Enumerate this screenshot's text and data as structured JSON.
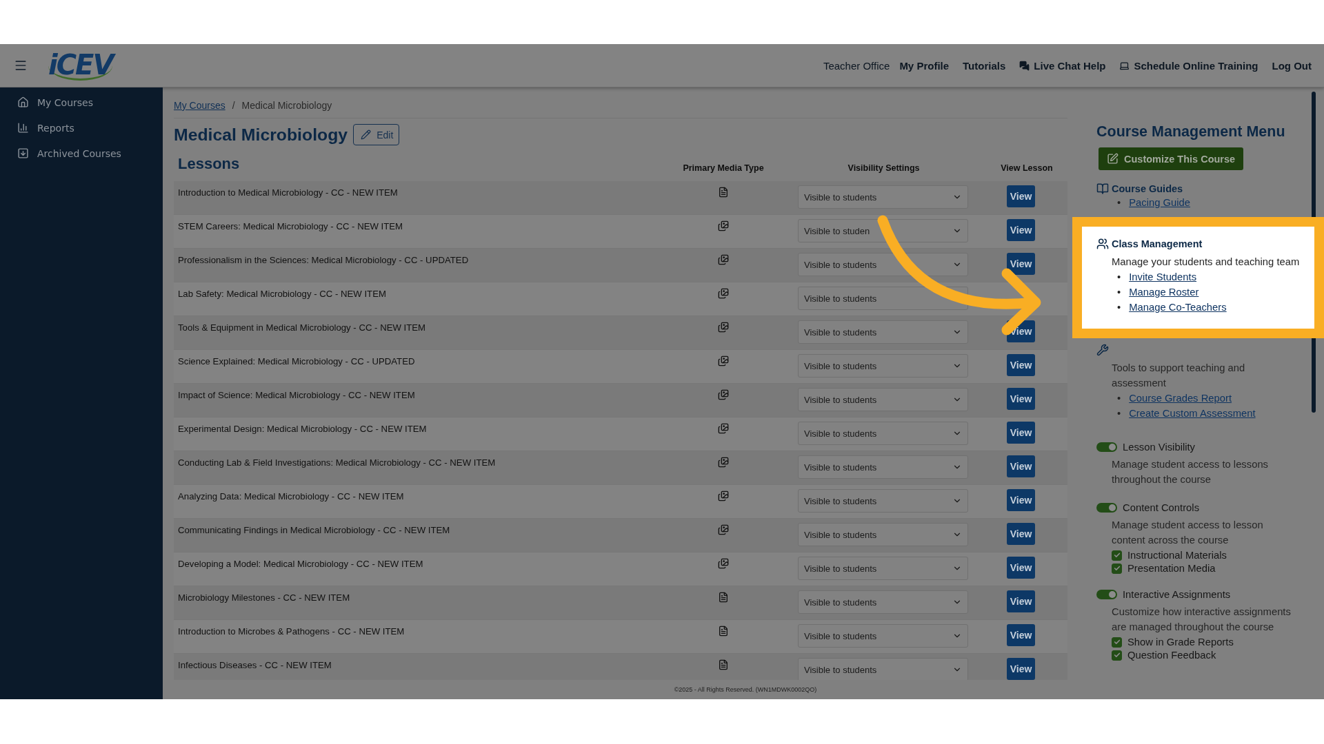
{
  "header": {
    "logo": "iCEV",
    "nav": [
      {
        "label": "Teacher Office",
        "selected": true
      },
      {
        "label": "My Profile",
        "selected": false
      },
      {
        "label": "Tutorials",
        "selected": false
      },
      {
        "label": "Live Chat Help",
        "selected": false
      },
      {
        "label": "Schedule Online Training",
        "selected": false
      },
      {
        "label": "Log Out",
        "selected": false
      }
    ]
  },
  "sidebar": {
    "items": [
      {
        "label": "My Courses"
      },
      {
        "label": "Reports"
      },
      {
        "label": "Archived Courses"
      }
    ]
  },
  "breadcrumb": {
    "link": "My Courses",
    "separator": "/",
    "current": "Medical Microbiology"
  },
  "course": {
    "title": "Medical Microbiology",
    "edit_button": "Edit"
  },
  "lessons": {
    "heading": "Lessons",
    "columns": [
      "Primary Media Type",
      "Visibility Settings",
      "View Lesson"
    ],
    "rows": [
      {
        "title": "Introduction to Medical Microbiology - CC - NEW ITEM",
        "kind": "document",
        "visibility": "Visible to students",
        "action": "View"
      },
      {
        "title": "STEM Careers: Medical Microbiology - CC - NEW ITEM",
        "kind": "slides",
        "visibility": "Visible to studen",
        "action": "View"
      },
      {
        "title": "Professionalism in the Sciences: Medical Microbiology - CC - UPDATED",
        "kind": "slides",
        "visibility": "Visible to students",
        "action": "View"
      },
      {
        "title": "Lab Safety: Medical Microbiology - CC - NEW ITEM",
        "kind": "slides",
        "visibility": "Visible to students"
      },
      {
        "title": "Tools & Equipment in Medical Microbiology - CC - NEW ITEM",
        "kind": "slides",
        "visibility": "Visible to students",
        "action": "View"
      },
      {
        "title": "Science Explained: Medical Microbiology - CC - UPDATED",
        "kind": "slides",
        "visibility": "Visible to students",
        "action": "View"
      },
      {
        "title": "Impact of Science: Medical Microbiology - CC - NEW ITEM",
        "kind": "slides",
        "visibility": "Visible to students",
        "action": "View"
      },
      {
        "title": "Experimental Design: Medical Microbiology - CC - NEW ITEM",
        "kind": "slides",
        "visibility": "Visible to students",
        "action": "View"
      },
      {
        "title": "Conducting Lab & Field Investigations: Medical Microbiology - CC - NEW ITEM",
        "kind": "slides",
        "visibility": "Visible to students",
        "action": "View"
      },
      {
        "title": "Analyzing Data: Medical Microbiology - CC - NEW ITEM",
        "kind": "slides",
        "visibility": "Visible to students",
        "action": "View"
      },
      {
        "title": "Communicating Findings in Medical Microbiology - CC - NEW ITEM",
        "kind": "slides",
        "visibility": "Visible to students",
        "action": "View"
      },
      {
        "title": "Developing a Model: Medical Microbiology - CC - NEW ITEM",
        "kind": "slides",
        "visibility": "Visible to students",
        "action": "View"
      },
      {
        "title": "Microbiology Milestones - CC - NEW ITEM",
        "kind": "document",
        "visibility": "Visible to students",
        "action": "View"
      },
      {
        "title": "Introduction to Microbes & Pathogens - CC - NEW ITEM",
        "kind": "document",
        "visibility": "Visible to students",
        "action": "View"
      },
      {
        "title": "Infectious Diseases - CC - NEW ITEM",
        "kind": "document",
        "visibility": "Visible to students",
        "action": "View"
      }
    ]
  },
  "management_menu": {
    "title": "Course Management Menu",
    "customize_button": "Customize This Course",
    "sections": [
      {
        "kind": "links",
        "heading": "Course Guides",
        "links": [
          {
            "marker": "•",
            "label": "Pacing Guide"
          }
        ]
      },
      {
        "kind": "highlight",
        "heading": "Class Management",
        "description": "Manage your students and teaching team",
        "links": [
          {
            "marker": "•",
            "label": "Invite Students"
          },
          {
            "marker": "•",
            "label": "Manage Roster"
          },
          {
            "marker": "•",
            "label": "Manage Co-Teachers"
          }
        ]
      },
      {
        "kind": "links",
        "description": "Tools to support teaching and assessment",
        "links": [
          {
            "marker": "•",
            "label": "Course Grades Report"
          },
          {
            "marker": "•",
            "label": "Create Custom Assessment"
          }
        ]
      },
      {
        "kind": "toggle",
        "heading": "Lesson Visibility",
        "on": true,
        "description": "Manage student access to lessons throughout the course"
      },
      {
        "kind": "toggle",
        "heading": "Content Controls",
        "on": true,
        "description": "Manage student access to lesson content across the course",
        "options": [
          {
            "label": "Instructional Materials",
            "checked": true
          },
          {
            "label": "Presentation Media",
            "checked": true
          }
        ]
      },
      {
        "kind": "toggle",
        "heading": "Interactive Assignments",
        "on": true,
        "description": "Customize how interactive assignments are managed throughout the course",
        "options": [
          {
            "label": "Show in Grade Reports",
            "checked": true
          },
          {
            "label": "Question Feedback",
            "checked": true
          }
        ]
      }
    ]
  },
  "footer": "©2025 - All Rights Reserved. (WN1MDWK0002QO)"
}
